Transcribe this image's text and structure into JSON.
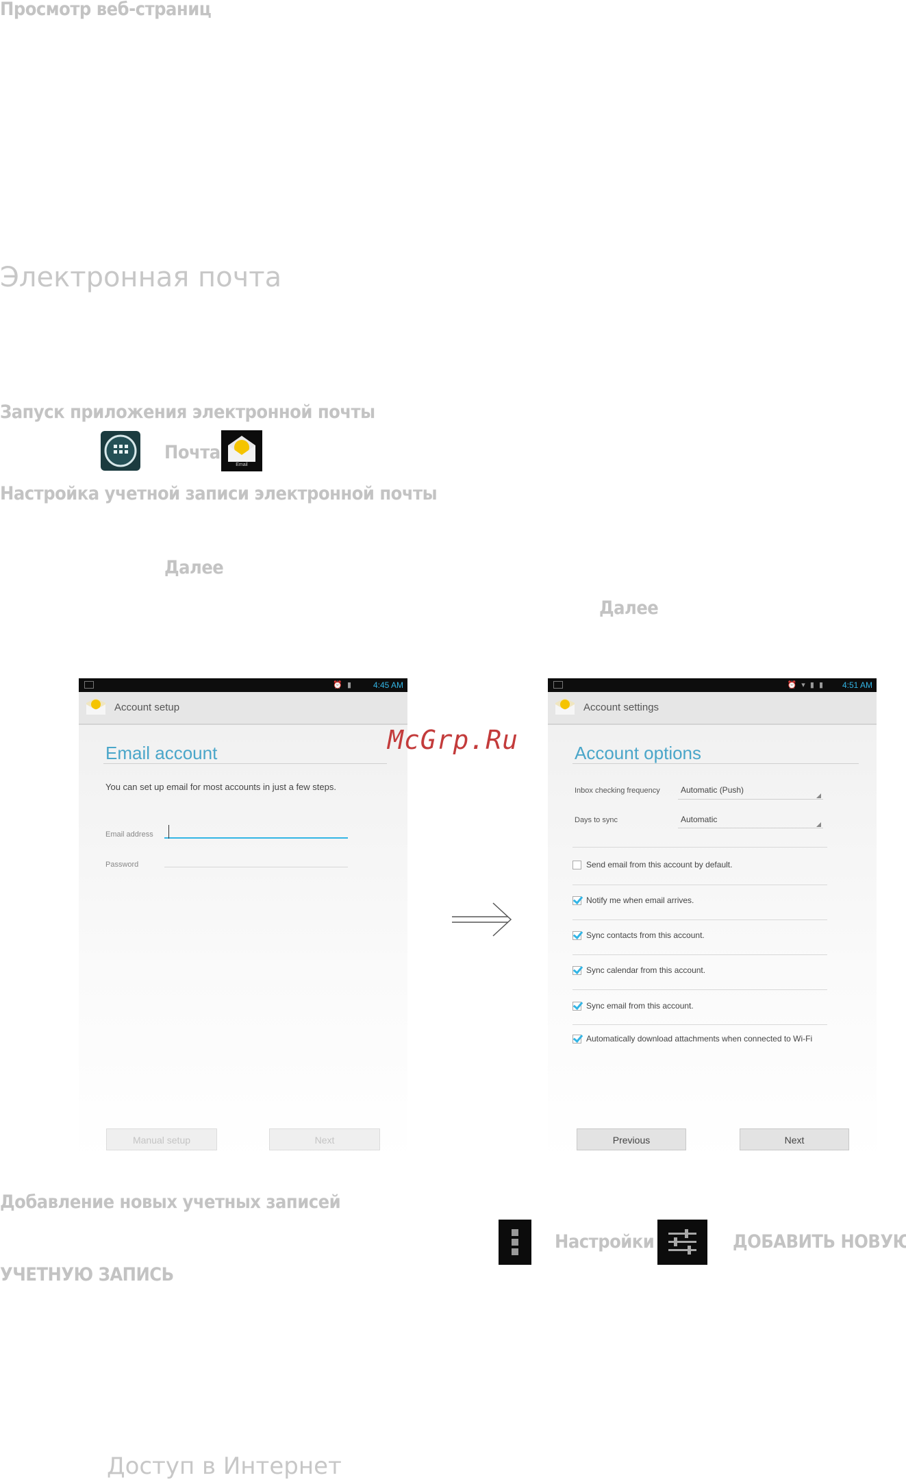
{
  "doc": {
    "header": "Просмотр веб-страниц",
    "section_title": "Электронная почта",
    "launch_heading": "Запуск приложения электронной почты",
    "launch_pochta": "Почта",
    "email_icon_caption": "Email",
    "setup_heading": "Настройка учетной записи электронной почты",
    "next_1": "Далее",
    "next_2": "Далее",
    "add_heading": "Добавление новых учетных записей",
    "settings_word": "Настройки",
    "add_account_part1": "ДОБАВИТЬ НОВУЮ",
    "add_account_part2": "УЧЕТНУЮ ЗАПИСЬ",
    "internet_heading": "Доступ в Интернет",
    "watermark": "McGrp.Ru"
  },
  "left_screen": {
    "time": "4:45 AM",
    "actionbar_title": "Account setup",
    "heading": "Email account",
    "intro": "You can set up email for most accounts in just a few steps.",
    "email_label": "Email address",
    "password_label": "Password",
    "manual_setup": "Manual setup",
    "next": "Next"
  },
  "right_screen": {
    "time": "4:51 AM",
    "actionbar_title": "Account settings",
    "heading": "Account options",
    "freq_label": "Inbox checking frequency",
    "freq_value": "Automatic (Push)",
    "days_label": "Days to sync",
    "days_value": "Automatic",
    "options": [
      {
        "label": "Send email from this account by default.",
        "checked": false
      },
      {
        "label": "Notify me when email arrives.",
        "checked": true
      },
      {
        "label": "Sync contacts from this account.",
        "checked": true
      },
      {
        "label": "Sync calendar from this account.",
        "checked": true
      },
      {
        "label": "Sync email from this account.",
        "checked": true
      },
      {
        "label": "Automatically download attachments when connected to Wi-Fi",
        "checked": true
      }
    ],
    "previous": "Previous",
    "next": "Next"
  }
}
